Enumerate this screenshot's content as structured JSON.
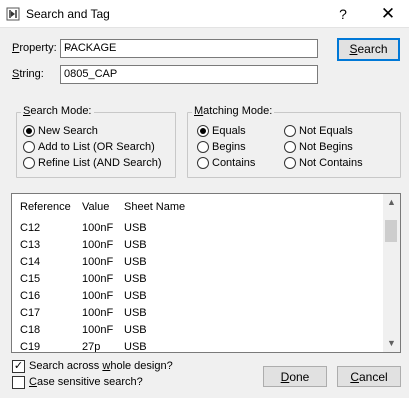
{
  "window": {
    "title": "Search and Tag",
    "help_label": "?",
    "close_label": "✕"
  },
  "property": {
    "label_underline": "P",
    "label_rest": "roperty:",
    "value": "PACKAGE"
  },
  "string": {
    "label_underline": "S",
    "label_rest": "tring:",
    "value": "0805_CAP"
  },
  "search_button": {
    "underline": "S",
    "rest": "earch"
  },
  "search_mode": {
    "title_underline": "S",
    "title_rest": "earch Mode:",
    "options": [
      {
        "label": "New Search",
        "checked": true
      },
      {
        "label": "Add to List (OR Search)",
        "checked": false
      },
      {
        "label": "Refine List (AND Search)",
        "checked": false
      }
    ]
  },
  "matching_mode": {
    "title_underline": "M",
    "title_rest": "atching Mode:",
    "options": [
      {
        "label": "Equals",
        "checked": true
      },
      {
        "label": "Begins",
        "checked": false
      },
      {
        "label": "Contains",
        "checked": false
      },
      {
        "label": "Not Equals",
        "checked": false
      },
      {
        "label": "Not Begins",
        "checked": false
      },
      {
        "label": "Not Contains",
        "checked": false
      }
    ]
  },
  "results": {
    "columns": [
      "Reference",
      "Value",
      "Sheet Name"
    ],
    "rows": [
      [
        "C12",
        "100nF",
        "USB"
      ],
      [
        "C13",
        "100nF",
        "USB"
      ],
      [
        "C14",
        "100nF",
        "USB"
      ],
      [
        "C15",
        "100nF",
        "USB"
      ],
      [
        "C16",
        "100nF",
        "USB"
      ],
      [
        "C17",
        "100nF",
        "USB"
      ],
      [
        "C18",
        "100nF",
        "USB"
      ],
      [
        "C19",
        "27p",
        "USB"
      ]
    ]
  },
  "options": {
    "whole_design_pre": "Search across ",
    "whole_design_underline": "w",
    "whole_design_post": "hole design?",
    "whole_design_checked": true,
    "case_underline": "C",
    "case_rest": "ase sensitive search?",
    "case_checked": false
  },
  "footer": {
    "done_underline": "D",
    "done_rest": "one",
    "cancel_underline": "C",
    "cancel_rest": "ancel"
  }
}
